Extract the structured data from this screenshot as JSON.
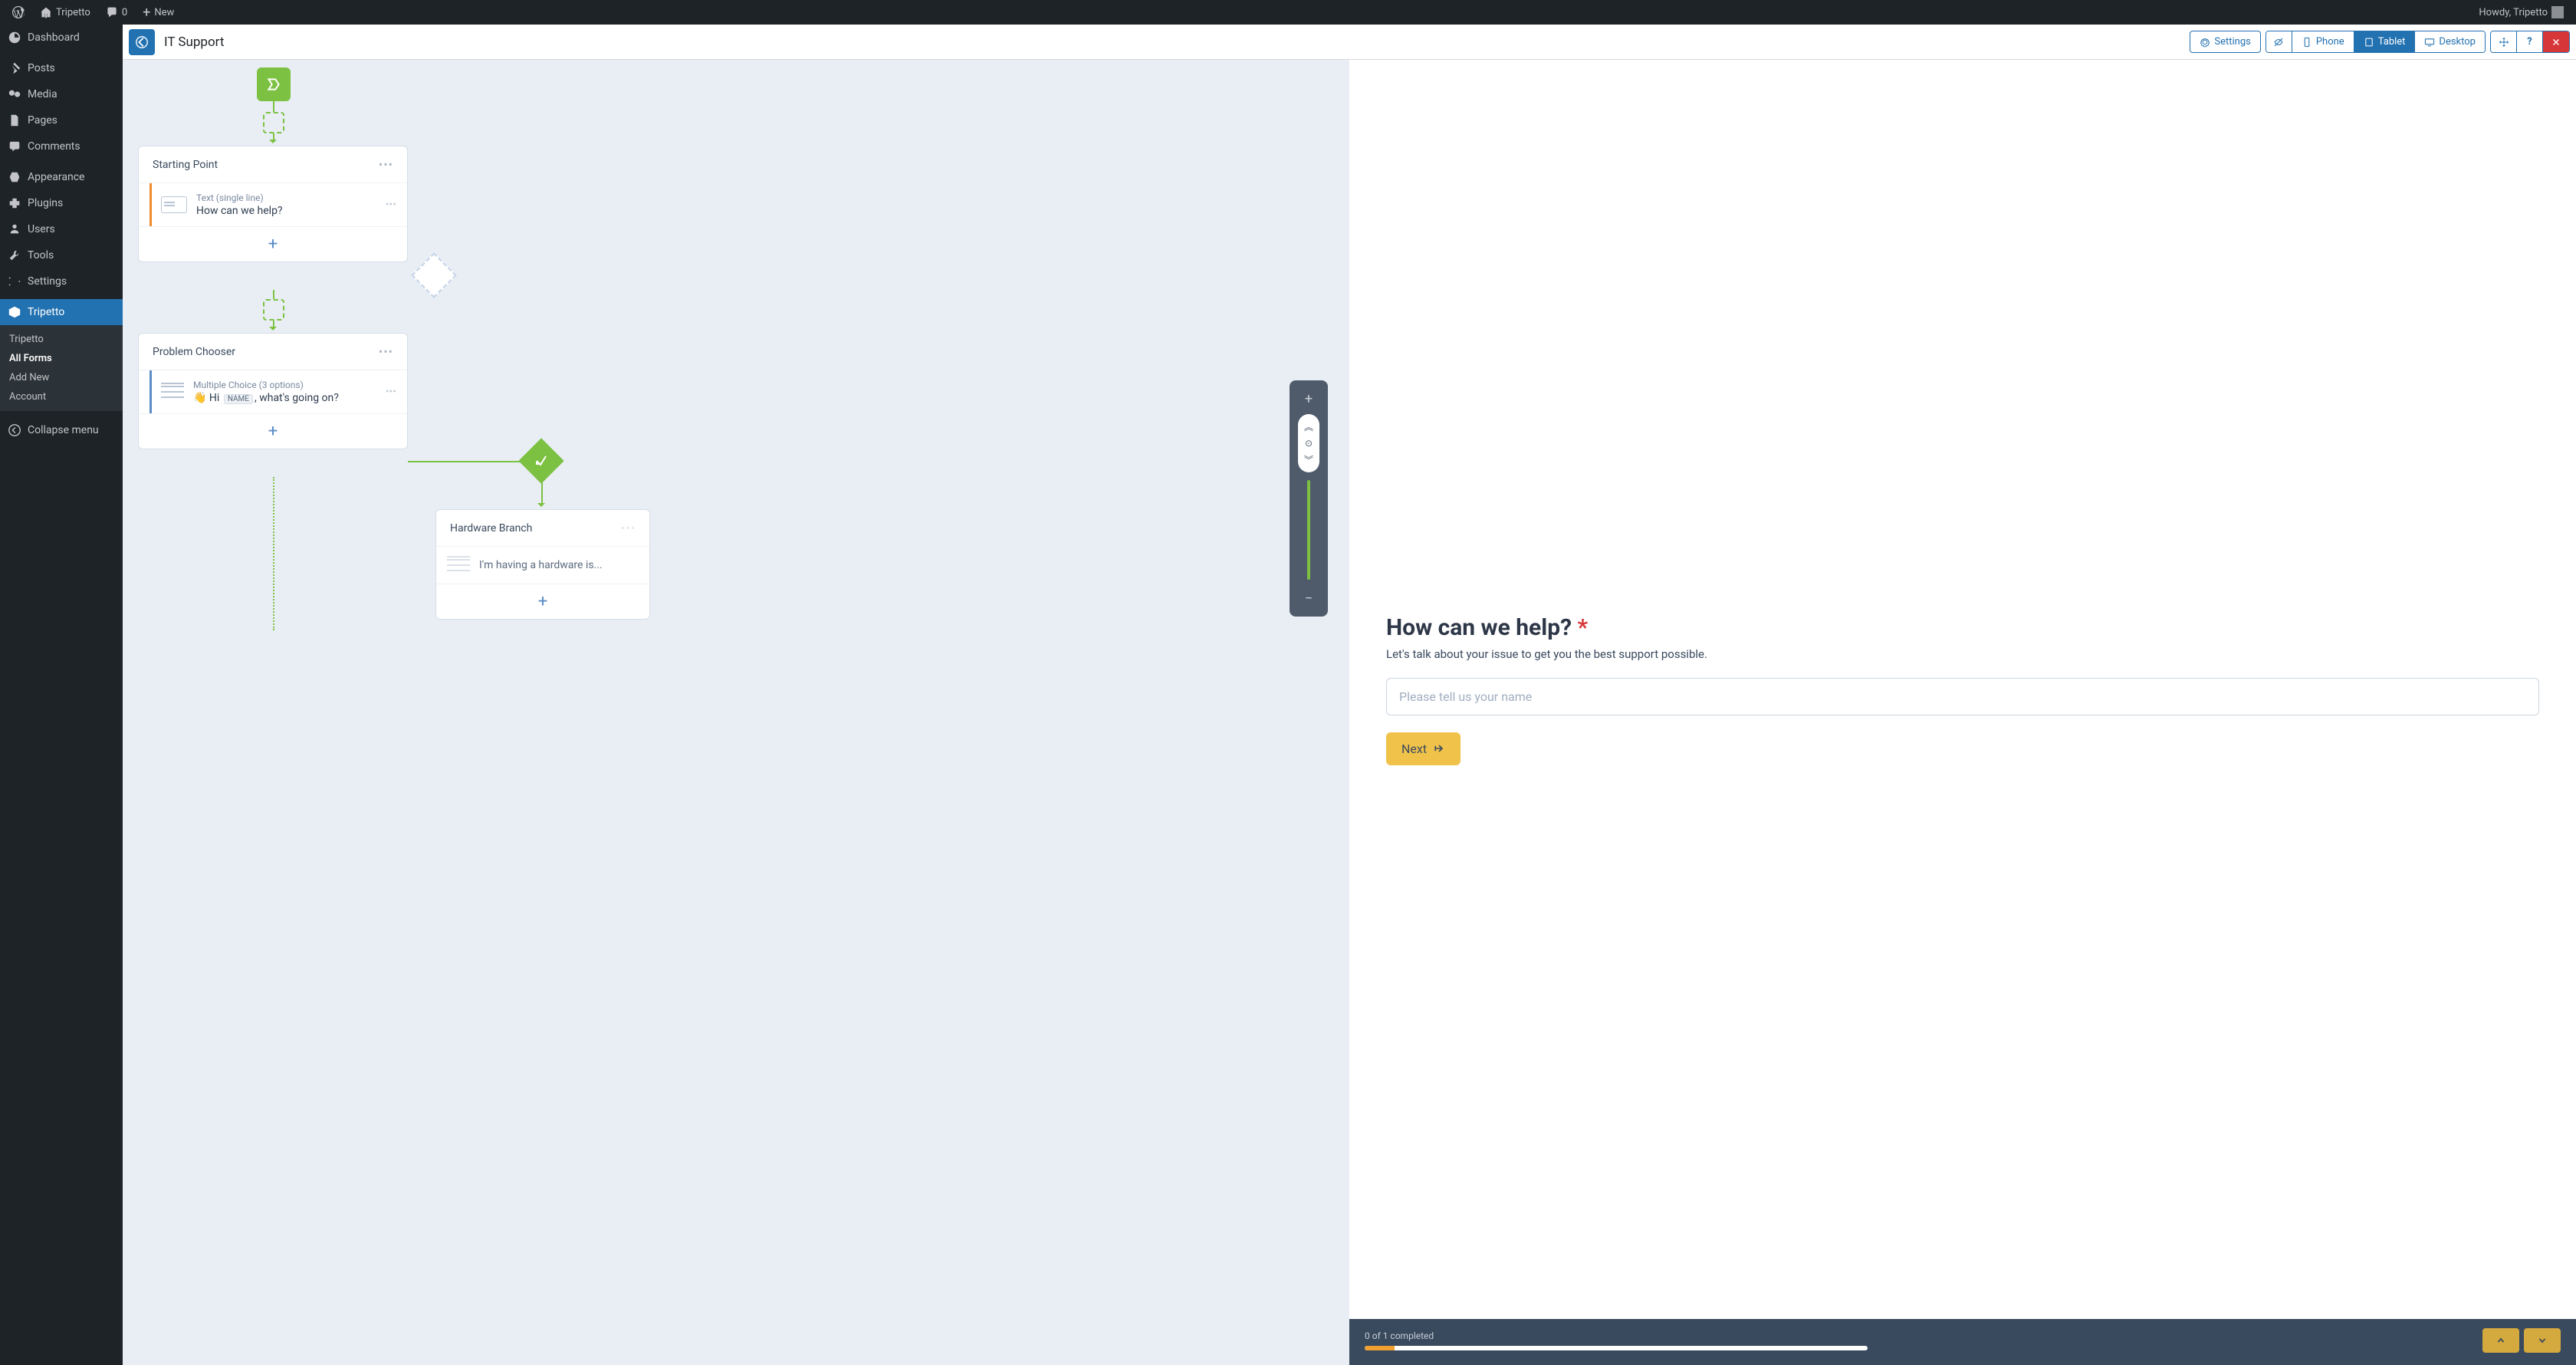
{
  "adminbar": {
    "site_name": "Tripetto",
    "comments_count": "0",
    "new_label": "New",
    "howdy": "Howdy, Tripetto"
  },
  "sidebar": {
    "items": [
      {
        "label": "Dashboard",
        "icon": "dashboard"
      },
      {
        "label": "Posts",
        "icon": "pin"
      },
      {
        "label": "Media",
        "icon": "media"
      },
      {
        "label": "Pages",
        "icon": "pages"
      },
      {
        "label": "Comments",
        "icon": "comment"
      },
      {
        "label": "Appearance",
        "icon": "appearance"
      },
      {
        "label": "Plugins",
        "icon": "plugin"
      },
      {
        "label": "Users",
        "icon": "users"
      },
      {
        "label": "Tools",
        "icon": "tools"
      },
      {
        "label": "Settings",
        "icon": "settings"
      },
      {
        "label": "Tripetto",
        "icon": "tripetto",
        "active": true
      }
    ],
    "submenu": [
      {
        "label": "Tripetto"
      },
      {
        "label": "All Forms",
        "active": true
      },
      {
        "label": "Add New"
      },
      {
        "label": "Account"
      }
    ],
    "collapse": "Collapse menu"
  },
  "toolbar": {
    "title": "IT Support",
    "settings": "Settings",
    "devices": {
      "phone": "Phone",
      "tablet": "Tablet",
      "desktop": "Desktop"
    }
  },
  "canvas": {
    "node1": {
      "title": "Starting Point",
      "type": "Text (single line)",
      "text": "How can we help?"
    },
    "node2": {
      "title": "Problem Chooser",
      "type": "Multiple Choice (3 options)",
      "emoji": "👋",
      "text_prefix": "Hi",
      "tag": "NAME",
      "text_suffix": ", what's going on?"
    },
    "node3": {
      "title": "Hardware Branch",
      "text": "I'm having a hardware is..."
    }
  },
  "preview": {
    "title": "How can we help?",
    "desc": "Let's talk about your issue to get you the best support possible.",
    "placeholder": "Please tell us your name",
    "next": "Next",
    "progress": "0 of 1 completed"
  }
}
